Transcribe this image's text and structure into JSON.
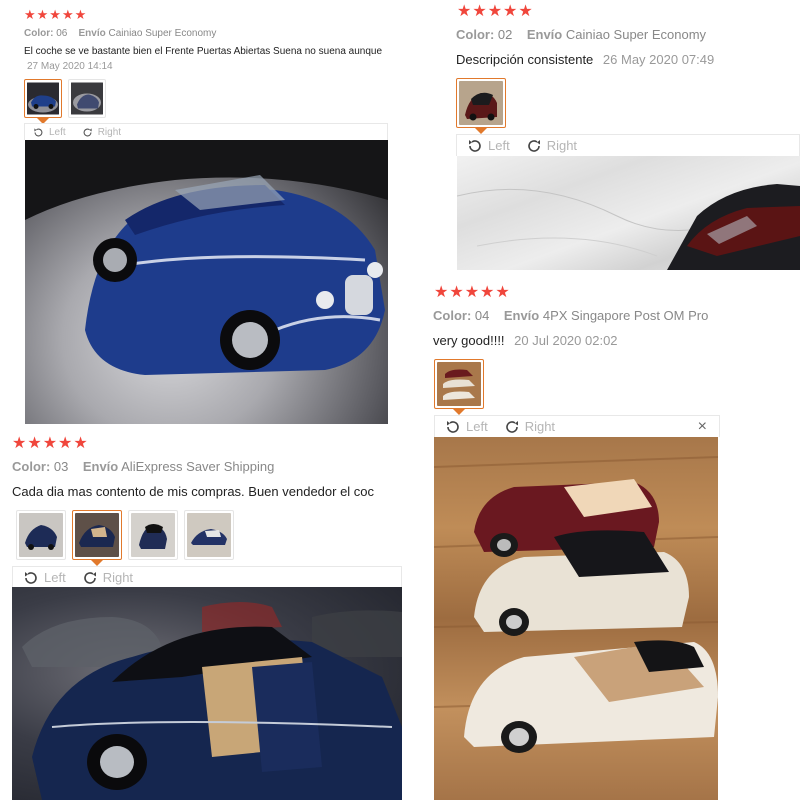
{
  "colors": {
    "star": "#f0463c",
    "active_border": "#e1792c",
    "muted": "#999999"
  },
  "rotate": {
    "left_label": "Left",
    "right_label": "Right"
  },
  "reviews": [
    {
      "stars": "★★★★★",
      "color_label": "Color:",
      "color_value": "06",
      "shipping_label": "Envío",
      "shipping_value": "Cainiao Super Economy",
      "text": "El coche se ve bastante bien el Frente Puertas Abiertas Suena no suena aunque",
      "date": "27 May 2020 14:14",
      "thumbnail_count": 2,
      "active_thumbnail": 0
    },
    {
      "stars": "★★★★★",
      "color_label": "Color:",
      "color_value": "02",
      "shipping_label": "Envío",
      "shipping_value": "Cainiao Super Economy",
      "text": "Descripción consistente",
      "date": "26 May 2020 07:49",
      "thumbnail_count": 1,
      "active_thumbnail": 0
    },
    {
      "stars": "★★★★★",
      "color_label": "Color:",
      "color_value": "04",
      "shipping_label": "Envío",
      "shipping_value": "4PX Singapore Post OM Pro",
      "text": "very good!!!!",
      "date": "20 Jul 2020 02:02",
      "thumbnail_count": 1,
      "active_thumbnail": 0,
      "close_icon": "×"
    },
    {
      "stars": "★★★★★",
      "color_label": "Color:",
      "color_value": "03",
      "shipping_label": "Envío",
      "shipping_value": "AliExpress Saver Shipping",
      "text": "Cada dia mas contento de mis compras. Buen vendedor el coc",
      "date": "",
      "thumbnail_count": 4,
      "active_thumbnail": 1
    }
  ]
}
